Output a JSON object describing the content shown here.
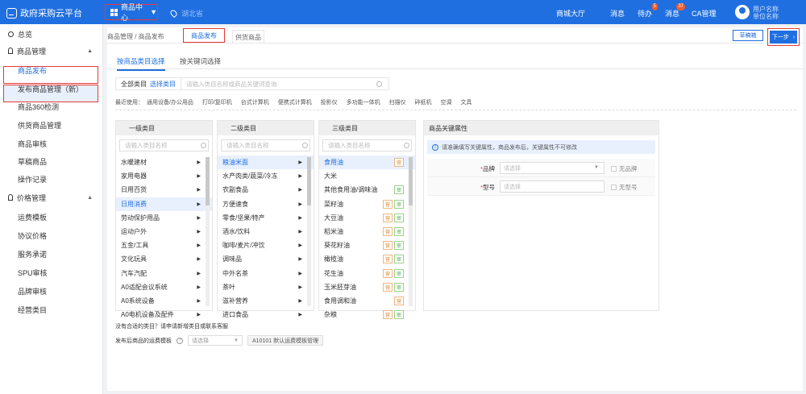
{
  "topbar": {
    "logo": "政府采购云平台",
    "center": "商品中心",
    "location": "湖北省",
    "nav": {
      "mall": "商城大厅",
      "notice": "消息",
      "todo": "待办",
      "todo_badge": "5",
      "message": "消息",
      "message_badge": "37",
      "ca": "CA管理"
    },
    "user": "用户名称",
    "user_sub": "单位名称"
  },
  "sidebar": {
    "items": [
      {
        "label": "总览"
      },
      {
        "label": "商品管理"
      },
      {
        "label": "商品发布"
      },
      {
        "label": "发布商品管理（新）"
      },
      {
        "label": "商品360检测"
      },
      {
        "label": "供货商品管理"
      },
      {
        "label": "商品审核"
      },
      {
        "label": "草稿商品"
      },
      {
        "label": "操作记录"
      },
      {
        "label": "价格管理"
      },
      {
        "label": "运费模板"
      },
      {
        "label": "协议价格"
      },
      {
        "label": "服务承诺"
      },
      {
        "label": "SPU审核"
      },
      {
        "label": "品牌审核"
      },
      {
        "label": "经营类目"
      }
    ]
  },
  "tabs": {
    "crumb1": "商品管理",
    "crumb2": "商品发布",
    "tab_active": "商品发布",
    "tab2": "供货商品",
    "reload": "草稿箱",
    "next": "下一步"
  },
  "subtabs": {
    "t1": "按商品类目选择",
    "t2": "按关键词选择"
  },
  "search": {
    "all": "全部类目",
    "select": "选择类目",
    "placeholder": "请输入类目名称或商品关键词查询"
  },
  "history": {
    "label": "最近使用：",
    "items": [
      "通用设备/办公用品",
      "打印/复印机",
      "台式计算机",
      "便携式计算机",
      "投影仪",
      "多功能一体机",
      "扫描仪",
      "碎纸机",
      "空调",
      "文具"
    ]
  },
  "col1": {
    "title": "一级类目",
    "placeholder": "请输入类目名称",
    "items": [
      "水暖建材",
      "家用电器",
      "日用百货",
      "日用消费",
      "劳动保护用品",
      "运动户外",
      "五金/工具",
      "文化玩具",
      "汽车汽配",
      "A0适配会议系统",
      "A0系统设备",
      "A0电机设备及配件"
    ]
  },
  "col2": {
    "title": "二级类目",
    "placeholder": "请输入类目名称",
    "items": [
      "粮油米面",
      "水产肉类/蔬菜/冷冻",
      "农副食品",
      "方便速食",
      "零食/坚果/特产",
      "酒水/饮料",
      "咖啡/麦片/冲饮",
      "调味品",
      "中外名茶",
      "茶叶",
      "滋补营养",
      "进口食品"
    ]
  },
  "col3": {
    "title": "三级类目",
    "placeholder": "请输入类目名称",
    "items": [
      "食用油",
      "大米",
      "其他食用油/调味油",
      "菜籽油",
      "大豆油",
      "稻米油",
      "葵花籽油",
      "橄榄油",
      "花生油",
      "玉米胚芽油",
      "食用调和油",
      "杂粮"
    ]
  },
  "attrs": {
    "title": "商品关键属性",
    "notice": "请准确填写关键属性，商品发布后，关键属性不可修改",
    "brand_label": "品牌",
    "brand_ph": "请选择",
    "brand_chk": "无品牌",
    "model_label": "型号",
    "model_ph": "请选择",
    "model_chk": "无型号"
  },
  "footer": {
    "note": "没有合适的类目？请申请新增类目或联系客服",
    "label": "发布后商品的运费模板",
    "select_ph": "请选择",
    "btn": "A10101 默认运费模板管理"
  },
  "colors": {
    "primary": "#1f6fe0",
    "highlight": "#e53935"
  }
}
